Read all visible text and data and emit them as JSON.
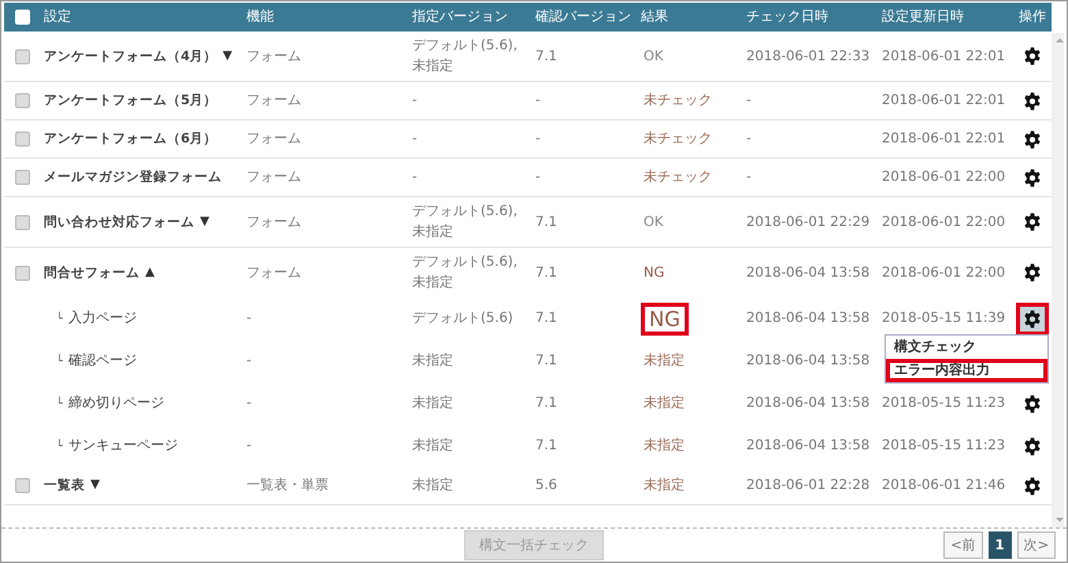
{
  "header": {
    "checked": false,
    "columns": [
      "設定",
      "機能",
      "指定バージョン",
      "確認バージョン",
      "結果",
      "チェック日時",
      "設定更新日時",
      "操作"
    ]
  },
  "rows": [
    {
      "name": "アンケートフォーム（4月）",
      "toggle": "▼",
      "checked": false,
      "feature": "フォーム",
      "spec_version": "デフォルト(5.6),未指定",
      "check_version": "7.1",
      "result": "OK",
      "color": "#8a8a8a",
      "checked_at": "2018-06-01 22:33",
      "updated_at": "2018-06-01 22:01",
      "highlighted": false
    },
    {
      "name": "アンケートフォーム（5月）",
      "checked": false,
      "feature": "フォーム",
      "spec_version": "-",
      "check_version": "-",
      "result": "未チェック",
      "color": "#9b6a55",
      "checked_at": "-",
      "updated_at": "2018-06-01 22:01",
      "highlighted": false
    },
    {
      "name": "アンケートフォーム（6月）",
      "checked": false,
      "feature": "フォーム",
      "spec_version": "-",
      "check_version": "-",
      "result": "未チェック",
      "color": "#9b6a55",
      "checked_at": "-",
      "updated_at": "2018-06-01 22:01",
      "highlighted": false
    },
    {
      "name": "メールマガジン登録フォーム",
      "checked": false,
      "feature": "フォーム",
      "spec_version": "-",
      "check_version": "-",
      "result": "未チェック",
      "color": "#9b6a55",
      "checked_at": "-",
      "updated_at": "2018-06-01 22:00",
      "highlighted": false
    },
    {
      "name": "問い合わせ対応フォーム",
      "toggle": "▼",
      "checked": false,
      "feature": "フォーム",
      "spec_version": "デフォルト(5.6),未指定",
      "check_version": "7.1",
      "result": "OK",
      "color": "#8a8a8a",
      "checked_at": "2018-06-01 22:29",
      "updated_at": "2018-06-01 22:00",
      "highlighted": false
    },
    {
      "name": "問合せフォーム",
      "toggle": "▲",
      "checked": false,
      "feature": "フォーム",
      "spec_version": "デフォルト(5.6),未指定",
      "check_version": "7.1",
      "result": "NG",
      "color": "#9b5a48",
      "checked_at": "2018-06-04 13:58",
      "updated_at": "2018-06-01 22:00",
      "highlighted": false,
      "children": [
        {
          "branch": "└",
          "name": "入力ページ",
          "feature": "-",
          "spec_version": "デフォルト(5.6)",
          "check_version": "7.1",
          "result": "NG",
          "color": "#9b5a48",
          "result_highlighted": true,
          "checked_at": "2018-06-04 13:58",
          "updated_at": "2018-05-15 11:39",
          "highlighted": true,
          "menu": [
            {
              "label": "構文チェック",
              "highlighted": false
            },
            {
              "label": "エラー内容出力",
              "highlighted": true
            }
          ]
        },
        {
          "branch": "└",
          "name": "確認ページ",
          "feature": "-",
          "spec_version": "未指定",
          "check_version": "7.1",
          "result": "未指定",
          "color": "#9b6a55",
          "checked_at": "2018-06-04 13:58"
        },
        {
          "branch": "└",
          "name": "締め切りページ",
          "feature": "-",
          "spec_version": "未指定",
          "check_version": "7.1",
          "result": "未指定",
          "color": "#9b6a55",
          "checked_at": "2018-06-04 13:58",
          "updated_at": "2018-05-15 11:23",
          "highlighted": false
        },
        {
          "branch": "└",
          "name": "サンキューページ",
          "feature": "-",
          "spec_version": "未指定",
          "check_version": "7.1",
          "result": "未指定",
          "color": "#9b6a55",
          "checked_at": "2018-06-04 13:58",
          "updated_at": "2018-05-15 11:23",
          "highlighted": false
        }
      ]
    },
    {
      "name": "一覧表",
      "toggle": "▼",
      "checked": false,
      "feature": "一覧表・単票",
      "spec_version": "未指定",
      "check_version": "5.6",
      "result": "未指定",
      "color": "#9b6a55",
      "checked_at": "2018-06-01 22:28",
      "updated_at": "2018-06-01 21:46",
      "highlighted": false
    }
  ],
  "footer": {
    "bulk_button": {
      "label": "構文一括チェック",
      "disabled": true
    },
    "pages": [
      {
        "label": "<前",
        "selected": false
      },
      {
        "label": "1",
        "selected": true
      },
      {
        "label": "次>",
        "selected": false
      }
    ]
  }
}
